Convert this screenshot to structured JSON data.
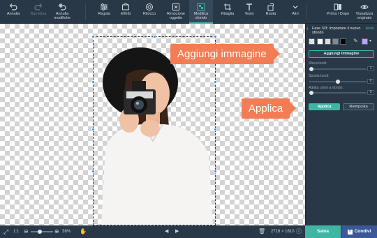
{
  "toolbar": {
    "undo": "Annulla",
    "redo": "Ripristina",
    "undo_all": "Annulla modifiche",
    "adjust": "Regola",
    "effects": "Effetti",
    "retouch": "Ritocco",
    "object_removal": "Rimozione oggetto",
    "change_bg": "Modifica sfondo",
    "crop": "Ritaglia",
    "text": "Testo",
    "rotate": "Ruota",
    "more": "Altri",
    "before_after": "Prima / Dopo",
    "view_original": "Visualizza originale"
  },
  "panel": {
    "title": "Fase 3/3: Impostare il nuovo sfondo",
    "auto": "Aiuto",
    "add_image": "Aggiungi immagine",
    "blur_label": "Sfoca bordi:",
    "blur_value": "1",
    "shift_label": "Sposta bordi:",
    "shift_value": "0",
    "adapt_label": "Adatta colori a sfondo:",
    "adapt_value": "0",
    "apply": "Applica",
    "reset": "Reimposta",
    "swatches": [
      "#ffffff",
      "#dcdcdc",
      "#888888",
      "#000000"
    ],
    "accent_swatch": "#b9a2ff"
  },
  "callouts": {
    "add_image": "Aggiungi immagine",
    "apply": "Applica"
  },
  "bottom": {
    "ratio": "1:1",
    "zoom": "38%",
    "dimensions": "2716 × 1810",
    "save": "Salva",
    "share": "Condivi"
  },
  "colors": {
    "accent": "#3fb6a4",
    "callout": "#f27d55",
    "toolbar": "#283846",
    "facebook": "#3b5998"
  }
}
